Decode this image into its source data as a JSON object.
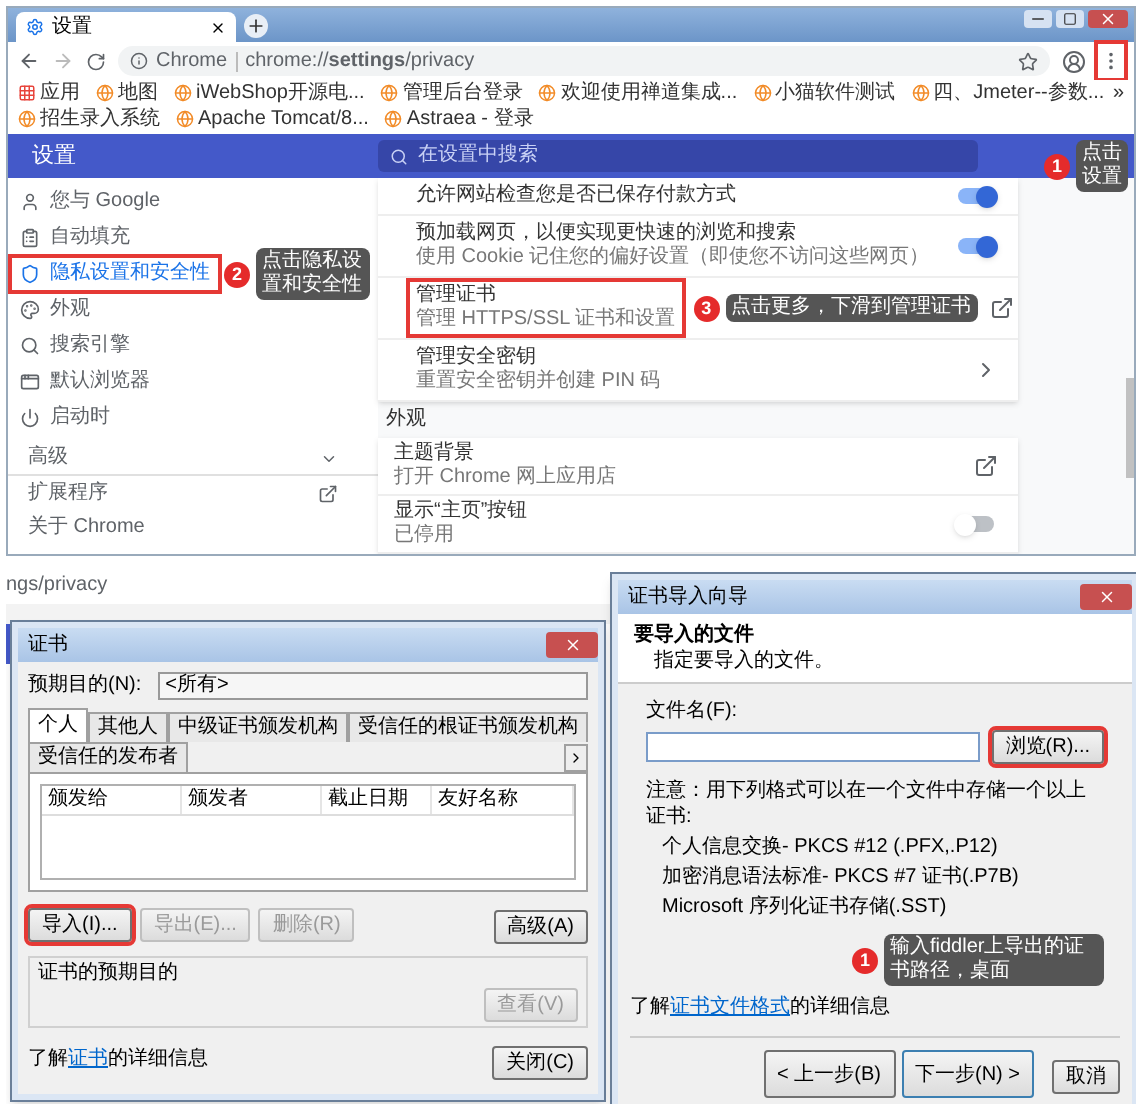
{
  "browser": {
    "tab_title": "设置",
    "scheme": "Chrome",
    "url": "chrome://**settings**/privacy",
    "menu_highlighted": true,
    "bookmarks": [
      {
        "kind": "apps",
        "label": "应用"
      },
      {
        "kind": "site",
        "label": "地图"
      },
      {
        "kind": "site",
        "label": "iWebShop开源电..."
      },
      {
        "kind": "site",
        "label": "管理后台登录"
      },
      {
        "kind": "site",
        "label": "欢迎使用禅道集成..."
      },
      {
        "kind": "site",
        "label": "小猫软件测试"
      },
      {
        "kind": "site",
        "label": "四、Jmeter--参数..."
      },
      {
        "kind": "site",
        "label": "招生录入系统"
      },
      {
        "kind": "site",
        "label": "Apache Tomcat/8..."
      },
      {
        "kind": "site",
        "label": "Astraea - 登录"
      }
    ],
    "more_bookmarks": "»"
  },
  "settings": {
    "title": "设置",
    "search_placeholder": "在设置中搜索",
    "callout": {
      "number": "1",
      "text": "点击设置"
    },
    "sidebar": {
      "items": [
        {
          "label": "您与 Google",
          "selected": false,
          "highlighted": false
        },
        {
          "label": "自动填充",
          "selected": false,
          "highlighted": false
        },
        {
          "label": "隐私设置和安全性",
          "selected": true,
          "highlighted": true
        },
        {
          "label": "外观",
          "selected": false,
          "highlighted": false
        },
        {
          "label": "搜索引擎",
          "selected": false,
          "highlighted": false
        },
        {
          "label": "默认浏览器",
          "selected": false,
          "highlighted": false
        },
        {
          "label": "启动时",
          "selected": false,
          "highlighted": false
        }
      ],
      "callout": {
        "number": "2",
        "text": "点击隐私设置和安全性"
      },
      "advanced": "高级",
      "extensions": "扩展程序",
      "about": "关于 Chrome"
    },
    "privacy_rows": [
      {
        "kind": "toggle",
        "title": "允许网站检查您是否已保存付款方式",
        "on": true,
        "highlighted": false
      },
      {
        "kind": "toggle",
        "title": "预加载网页，以便实现更快速的浏览和搜索",
        "subtitle": "使用 Cookie 记住您的偏好设置（即使您不访问这些网页）",
        "on": true,
        "highlighted": false
      },
      {
        "kind": "external",
        "title": "管理证书",
        "subtitle": "管理 HTTPS/SSL 证书和设置",
        "highlighted": true,
        "callout": {
          "number": "3",
          "text": "点击更多，下滑到管理证书"
        }
      },
      {
        "kind": "arrow",
        "title": "管理安全密钥",
        "subtitle": "重置安全密钥并创建 PIN 码",
        "highlighted": false
      }
    ],
    "appearance": {
      "heading": "外观",
      "rows": [
        {
          "kind": "external",
          "title": "主题背景",
          "subtitle": "打开 Chrome 网上应用店"
        },
        {
          "kind": "toggle",
          "title": "显示“主页”按钮",
          "subtitle": "已停用",
          "on": false
        }
      ]
    }
  },
  "lower_browser": {
    "url_fragment": "ngs/privacy"
  },
  "cert_dialog": {
    "title": "证书",
    "purpose_label": "预期目的(N):",
    "purpose_value": "<所有>",
    "tabs": [
      {
        "label": "个人",
        "selected": true
      },
      {
        "label": "其他人",
        "selected": false
      },
      {
        "label": "中级证书颁发机构",
        "selected": false
      },
      {
        "label": "受信任的根证书颁发机构",
        "selected": false
      },
      {
        "label": "受信任的发布者",
        "selected": false
      }
    ],
    "columns": [
      "颁发给",
      "颁发者",
      "截止日期",
      "友好名称"
    ],
    "buttons": [
      {
        "label": "导入(I)...",
        "disabled": false,
        "highlighted": true
      },
      {
        "label": "导出(E)...",
        "disabled": true,
        "highlighted": false
      },
      {
        "label": "删除(R)",
        "disabled": true,
        "highlighted": false
      }
    ],
    "advanced_button": "高级(A)",
    "purposes_heading": "证书的预期目的",
    "view_button": {
      "label": "查看(V)",
      "disabled": true
    },
    "footer": {
      "before": "了解",
      "link": "证书",
      "after": "的详细信息"
    },
    "close_button": "关闭(C)"
  },
  "import_wizard": {
    "title": "证书导入向导",
    "heading": "要导入的文件",
    "subheading": "指定要导入的文件。",
    "file_label": "文件名(F):",
    "browse_button": {
      "label": "浏览(R)...",
      "highlighted": true
    },
    "note": "注意：用下列格式可以在一个文件中存储一个以上证书:",
    "formats": [
      "个人信息交换- PKCS #12 (.PFX,.P12)",
      "加密消息语法标准- PKCS #7 证书(.P7B)",
      "Microsoft 序列化证书存储(.SST)"
    ],
    "callout": {
      "number": "1",
      "text": "输入fiddler上导出的证书路径，桌面"
    },
    "footer": {
      "before": "了解",
      "link": "证书文件格式",
      "after": "的详细信息"
    },
    "back_button": "< 上一步(B)",
    "next_button": "下一步(N) >",
    "cancel_button": "取消"
  }
}
